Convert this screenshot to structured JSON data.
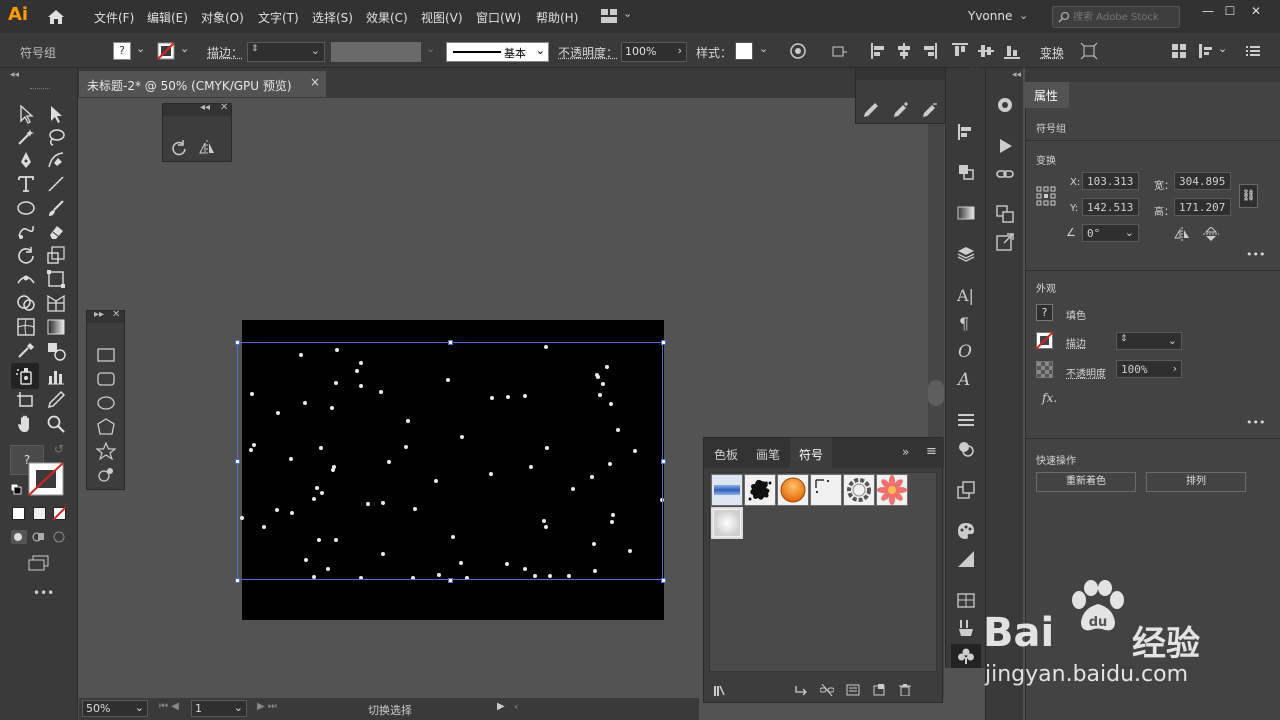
{
  "app": {
    "logo": "Ai"
  },
  "menu": [
    "文件(F)",
    "编辑(E)",
    "对象(O)",
    "文字(T)",
    "选择(S)",
    "效果(C)",
    "视图(V)",
    "窗口(W)",
    "帮助(H)"
  ],
  "user": {
    "name": "Yvonne"
  },
  "search": {
    "placeholder": "搜索 Adobe Stock"
  },
  "window_controls": {
    "minimize": "—",
    "maximize": "☐",
    "close": "✕"
  },
  "control": {
    "selection_type": "符号组",
    "fill_unknown": "?",
    "stroke_label": "描边：",
    "stroke_style": "基本",
    "opacity_label": "不透明度：",
    "opacity_value": "100%",
    "style_label": "样式：",
    "transform_label": "变换"
  },
  "document": {
    "tab_title": "未标题-2* @ 50% (CMYK/GPU 预览)",
    "close": "×"
  },
  "status": {
    "zoom": "50%",
    "page": "1",
    "mode": "切换选择"
  },
  "symbols_panel": {
    "tabs": [
      "色板",
      "画笔",
      "符号"
    ],
    "active_tab": "符号"
  },
  "properties": {
    "tab": "属性",
    "selection": "符号组",
    "transform_title": "变换",
    "x_label": "X:",
    "x_value": "103.313",
    "y_label": "Y:",
    "y_value": "142.513",
    "w_label": "宽：",
    "w_value": "304.895",
    "h_label": "高：",
    "h_value": "171.207",
    "angle_value": "0°",
    "appearance_title": "外观",
    "fill_label": "填色",
    "fill_unknown": "?",
    "stroke_label": "描边",
    "opacity_label": "不透明度",
    "opacity_value": "100%",
    "fx_label": "fx.",
    "quick_actions_title": "快速操作",
    "recolor_button": "重新着色",
    "arrange_button": "排列",
    "more": "•••"
  },
  "watermark": {
    "brand": "Bai",
    "brand2": "du",
    "tagline": "经验",
    "url": "jingyan.baidu.com"
  },
  "colors": {
    "accent": "#ff9a00",
    "selection": "#4b6bd6",
    "stroke_red": "#e02020"
  }
}
